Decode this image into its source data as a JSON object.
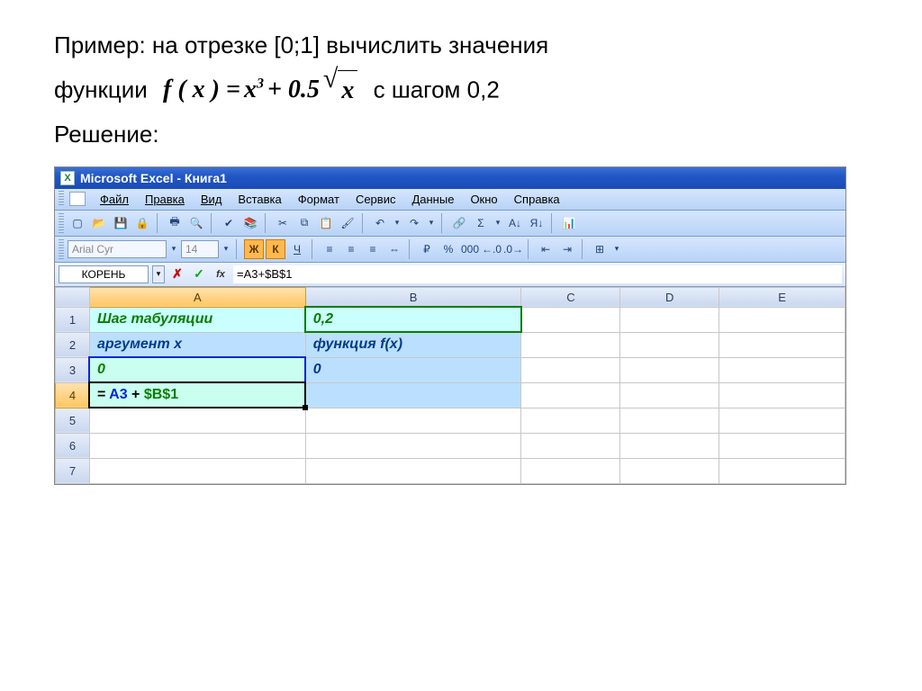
{
  "task": {
    "line1": "Пример: на отрезке [0;1] вычислить значения",
    "line2a": "функции",
    "formula_lhs": "f ( x ) =",
    "formula_term1": "x",
    "formula_exp": "3",
    "formula_plus": "+ 0.5",
    "formula_rad": "x",
    "line2b": "с шагом 0,2",
    "line3": "Решение:"
  },
  "window": {
    "title": "Microsoft Excel - Книга1"
  },
  "menu": {
    "items": [
      "Файл",
      "Правка",
      "Вид",
      "Вставка",
      "Формат",
      "Сервис",
      "Данные",
      "Окно",
      "Справка"
    ]
  },
  "formatbar": {
    "font": "Arial Cyr",
    "size": "14",
    "bold": "Ж",
    "italic": "К",
    "underline": "Ч"
  },
  "icons": {
    "new": "▢",
    "open": "📂",
    "save": "💾",
    "perm": "🔒",
    "print": "🖶",
    "preview": "🔍",
    "spell": "✔",
    "research": "📚",
    "cut": "✂",
    "copy": "⧉",
    "paste": "📋",
    "fmtpaint": "🖌",
    "undo": "↶",
    "redo": "↷",
    "link": "🔗",
    "sum": "Σ",
    "sortaz": "A↓",
    "sortza": "Я↓",
    "chart": "📊",
    "alignL": "≡",
    "alignC": "≡",
    "alignR": "≡",
    "merge": "⇔",
    "currency": "₽",
    "percent": "%",
    "comma": "000",
    "incdec": "←.0",
    "decinc": ".0→",
    "indentL": "⇤",
    "indentR": "⇥",
    "borders": "⊞"
  },
  "formulabar": {
    "namebox": "КОРЕНЬ",
    "formula": "=A3+$B$1"
  },
  "columns": [
    "A",
    "B",
    "C",
    "D",
    "E"
  ],
  "rows": [
    "1",
    "2",
    "3",
    "4",
    "5",
    "6",
    "7"
  ],
  "cells": {
    "A1": "Шаг табуляции",
    "B1": "0,2",
    "A2": "аргумент x",
    "B2": "функция f(x)",
    "A3": "0",
    "B3": "0",
    "A4_prefix": "= ",
    "A4_a3": "A3",
    "A4_plus": " + ",
    "A4_b1": "$B$1"
  },
  "chart_data": {
    "type": "table",
    "title": "Excel worksheet cells",
    "columns": [
      "A",
      "B"
    ],
    "rows": [
      {
        "A": "Шаг табуляции",
        "B": "0,2"
      },
      {
        "A": "аргумент x",
        "B": "функция f(x)"
      },
      {
        "A": "0",
        "B": "0"
      },
      {
        "A": "=A3+$B$1",
        "B": ""
      }
    ],
    "active_cell": "A4",
    "formula_bar": "=A3+$B$1"
  }
}
